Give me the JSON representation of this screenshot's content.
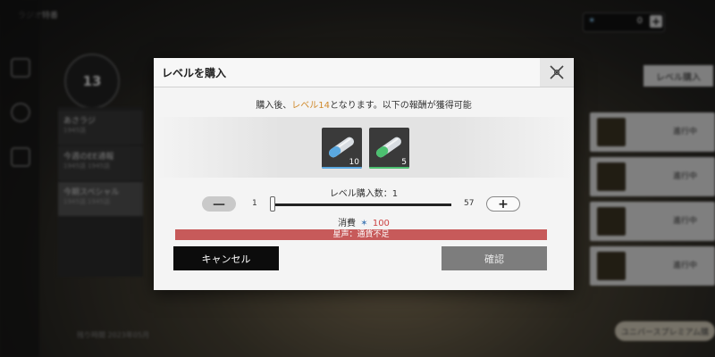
{
  "background": {
    "top_title": "ラジオ特番",
    "level_number": "13",
    "channels": [
      {
        "name": "あさラジ",
        "sub": "1945話"
      },
      {
        "name": "今週のEE通報",
        "sub": "1945話 1945話"
      },
      {
        "name": "今期スペシャル",
        "sub": "1945話 1945話"
      }
    ],
    "currency_value": "0",
    "currency_plus": "+",
    "buy_level_button": "レベル購入",
    "row_status": [
      "進行中",
      "進行中",
      "進行中",
      "進行中"
    ],
    "bottom_pill": "ユニバースプレミアム購",
    "bottom_info": "残り時間 2023年05月"
  },
  "modal": {
    "title": "レベルを購入",
    "notice_prefix": "購入後、",
    "notice_highlight": "レベル14",
    "notice_suffix": "となります。以下の報酬が獲得可能",
    "items": [
      {
        "icon": "capsule-blue-icon",
        "qty": "10",
        "bar_color": "#5aa8e0"
      },
      {
        "icon": "capsule-green-icon",
        "qty": "5",
        "bar_color": "#4cc070"
      }
    ],
    "quantity_label": "レベル購入数：1",
    "slider": {
      "min": "1",
      "max": "57",
      "value": 1
    },
    "minus_label": "—",
    "plus_label": "+",
    "cost_label": "消費",
    "cost_value": "100",
    "warning": "星声：通貨不足",
    "cancel_label": "キャンセル",
    "confirm_label": "確認"
  }
}
